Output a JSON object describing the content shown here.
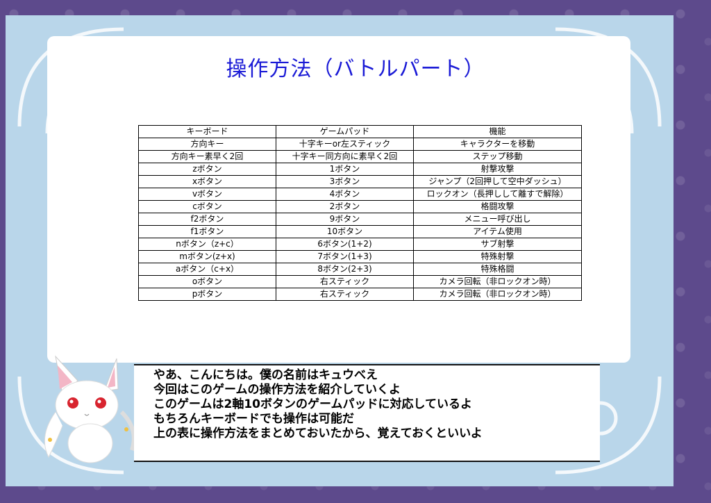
{
  "title": "操作方法（バトルパート）",
  "table": {
    "headers": [
      "キーボード",
      "ゲームパッド",
      "機能"
    ],
    "rows": [
      [
        "方向キー",
        "十字キーor左スティック",
        "キャラクターを移動"
      ],
      [
        "方向キー素早く2回",
        "十字キー同方向に素早く2回",
        "ステップ移動"
      ],
      [
        "zボタン",
        "1ボタン",
        "射撃攻撃"
      ],
      [
        "xボタン",
        "3ボタン",
        "ジャンプ（2回押して空中ダッシュ）"
      ],
      [
        "vボタン",
        "4ボタン",
        "ロックオン（長押しして離すで解除）"
      ],
      [
        "cボタン",
        "2ボタン",
        "格闘攻撃"
      ],
      [
        "f2ボタン",
        "9ボタン",
        "メニュー呼び出し"
      ],
      [
        "f1ボタン",
        "10ボタン",
        "アイテム使用"
      ],
      [
        "nボタン（z+c）",
        "6ボタン(1+2)",
        "サブ射撃"
      ],
      [
        "mボタン(z+x)",
        "7ボタン(1+3)",
        "特殊射撃"
      ],
      [
        "aボタン（c+x）",
        "8ボタン(2+3)",
        "特殊格闘"
      ],
      [
        "oボタン",
        "右スティック",
        "カメラ回転（非ロックオン時）"
      ],
      [
        "pボタン",
        "右スティック",
        "カメラ回転（非ロックオン時）"
      ]
    ]
  },
  "dialog": {
    "lines": [
      "やあ、こんにちは。僕の名前はキュウべえ",
      "今回はこのゲームの操作方法を紹介していくよ",
      "このゲームは2軸10ボタンのゲームパッドに対応しているよ",
      "もちろんキーボードでも操作は可能だ",
      "上の表に操作方法をまとめておいたから、覚えておくといいよ"
    ]
  },
  "colors": {
    "title": "#1a1ad6",
    "frame": "#b9d6ea",
    "background": "#5d4a8c"
  },
  "icons": {
    "character": "kyubey-portrait"
  }
}
